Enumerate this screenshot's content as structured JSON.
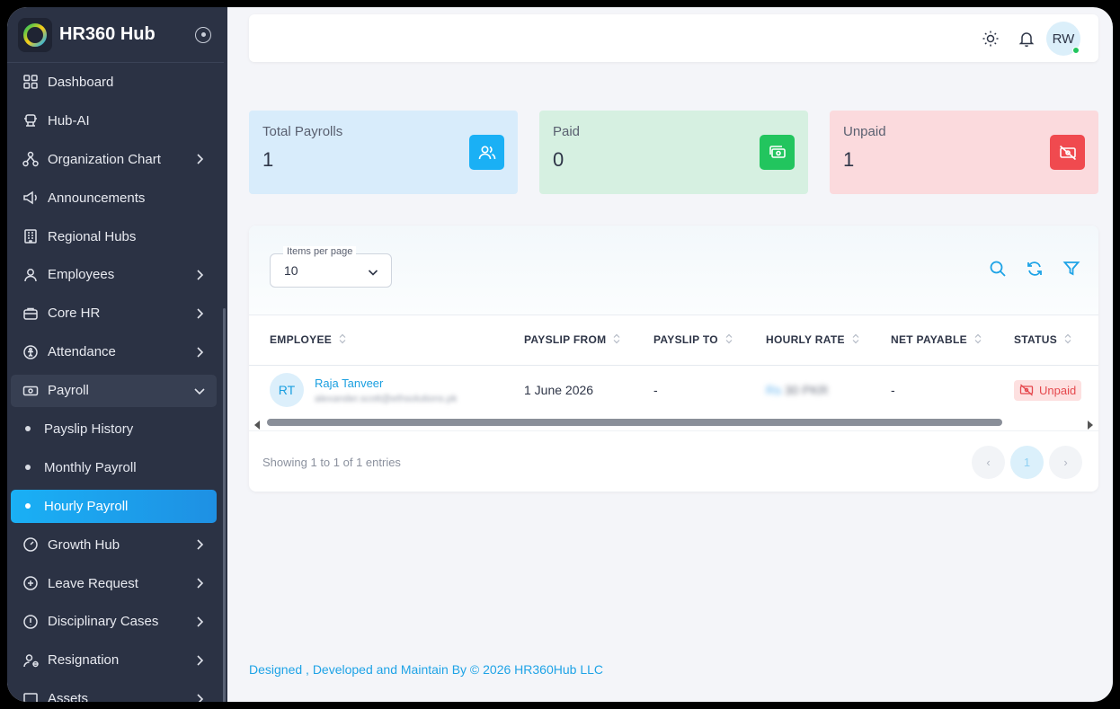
{
  "app": {
    "title": "HR360 Hub"
  },
  "sidebar": {
    "items": [
      {
        "label": "Dashboard",
        "icon": "dashboard-icon",
        "has_children": false
      },
      {
        "label": "Hub-AI",
        "icon": "robot-icon",
        "has_children": false
      },
      {
        "label": "Organization Chart",
        "icon": "org-chart-icon",
        "has_children": true
      },
      {
        "label": "Announcements",
        "icon": "megaphone-icon",
        "has_children": false
      },
      {
        "label": "Regional Hubs",
        "icon": "building-icon",
        "has_children": false
      },
      {
        "label": "Employees",
        "icon": "user-icon",
        "has_children": true
      },
      {
        "label": "Core HR",
        "icon": "briefcase-icon",
        "has_children": true
      },
      {
        "label": "Attendance",
        "icon": "attendance-icon",
        "has_children": true
      },
      {
        "label": "Payroll",
        "icon": "cash-icon",
        "has_children": true,
        "expanded": true
      },
      {
        "label": "Growth Hub",
        "icon": "gauge-icon",
        "has_children": true
      },
      {
        "label": "Leave Request",
        "icon": "plus-circle-icon",
        "has_children": true
      },
      {
        "label": "Disciplinary Cases",
        "icon": "alert-circle-icon",
        "has_children": true
      },
      {
        "label": "Resignation",
        "icon": "user-minus-icon",
        "has_children": true
      },
      {
        "label": "Assets",
        "icon": "monitor-icon",
        "has_children": true
      }
    ],
    "payroll_sub": [
      {
        "label": "Payslip History",
        "active": false
      },
      {
        "label": "Monthly Payroll",
        "active": false
      },
      {
        "label": "Hourly Payroll",
        "active": true
      }
    ]
  },
  "topbar": {
    "user_initials": "RW"
  },
  "stats": [
    {
      "title": "Total Payrolls",
      "value": "1",
      "bg": "#d8ecfb",
      "icon_bg": "#1ab0f5",
      "icon": "users-icon"
    },
    {
      "title": "Paid",
      "value": "0",
      "bg": "#d6f0e1",
      "icon_bg": "#22c55e",
      "icon": "money-icon"
    },
    {
      "title": "Unpaid",
      "value": "1",
      "bg": "#fbdadd",
      "icon_bg": "#f04a4f",
      "icon": "money-off-icon"
    }
  ],
  "table": {
    "items_per_page_label": "Items per page",
    "items_per_page": "10",
    "columns": [
      "EMPLOYEE",
      "PAYSLIP FROM",
      "PAYSLIP TO",
      "HOURLY RATE",
      "NET PAYABLE",
      "STATUS"
    ],
    "rows": [
      {
        "initials": "RT",
        "name": "Raja Tanveer",
        "email": "alexander.scott@ethsolutions.pk",
        "payslip_from": "1 June 2026",
        "payslip_to": "-",
        "hourly_rate_currency": "Rs",
        "hourly_rate_value": "30 PKR",
        "net_payable": "-",
        "status": "Unpaid"
      }
    ],
    "showing": "Showing 1 to 1 of 1 entries",
    "current_page": "1",
    "prev_symbol": "‹",
    "next_symbol": "›"
  },
  "footer": {
    "text": "Designed , Developed and Maintain By © 2026 HR360Hub LLC"
  }
}
